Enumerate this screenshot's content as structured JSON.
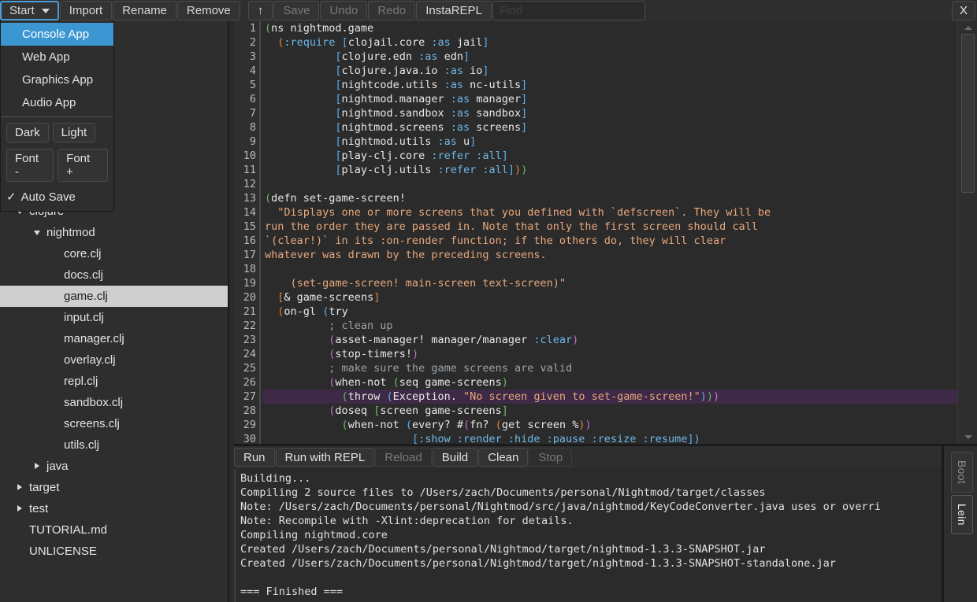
{
  "toolbar": {
    "start_label": "Start",
    "import_label": "Import",
    "rename_label": "Rename",
    "remove_label": "Remove",
    "up_label": "↑",
    "save_label": "Save",
    "undo_label": "Undo",
    "redo_label": "Redo",
    "instarepl_label": "InstaREPL",
    "find_placeholder": "Find",
    "find_value": "",
    "close_label": "X"
  },
  "start_menu": {
    "items": [
      {
        "label": "Console App",
        "selected": true
      },
      {
        "label": "Web App",
        "selected": false
      },
      {
        "label": "Graphics App",
        "selected": false
      },
      {
        "label": "Audio App",
        "selected": false
      }
    ],
    "theme_dark": "Dark",
    "theme_light": "Light",
    "font_minus": "Font -",
    "font_plus": "Font +",
    "auto_save_check": "✓",
    "auto_save_label": "Auto Save"
  },
  "sidebar": {
    "tree": [
      {
        "label": "clojure",
        "indent": 1,
        "twisty": "down"
      },
      {
        "label": "nightmod",
        "indent": 2,
        "twisty": "down"
      },
      {
        "label": "core.clj",
        "indent": 3,
        "twisty": "none"
      },
      {
        "label": "docs.clj",
        "indent": 3,
        "twisty": "none"
      },
      {
        "label": "game.clj",
        "indent": 3,
        "twisty": "none",
        "selected": true
      },
      {
        "label": "input.clj",
        "indent": 3,
        "twisty": "none"
      },
      {
        "label": "manager.clj",
        "indent": 3,
        "twisty": "none"
      },
      {
        "label": "overlay.clj",
        "indent": 3,
        "twisty": "none"
      },
      {
        "label": "repl.clj",
        "indent": 3,
        "twisty": "none"
      },
      {
        "label": "sandbox.clj",
        "indent": 3,
        "twisty": "none"
      },
      {
        "label": "screens.clj",
        "indent": 3,
        "twisty": "none"
      },
      {
        "label": "utils.clj",
        "indent": 3,
        "twisty": "none"
      },
      {
        "label": "java",
        "indent": 2,
        "twisty": "right"
      },
      {
        "label": "target",
        "indent": 1,
        "twisty": "right"
      },
      {
        "label": "test",
        "indent": 1,
        "twisty": "right"
      },
      {
        "label": "TUTORIAL.md",
        "indent": 1,
        "twisty": "none"
      },
      {
        "label": "UNLICENSE",
        "indent": 1,
        "twisty": "none"
      }
    ]
  },
  "editor": {
    "first_line": 1,
    "last_line": 30,
    "current_line": 27,
    "lines": [
      {
        "n": 1,
        "tokens": [
          {
            "t": "(",
            "c": "p4"
          },
          {
            "t": "ns nightmod.game",
            "c": ""
          }
        ]
      },
      {
        "n": 2,
        "tokens": [
          {
            "t": "  ",
            "c": ""
          },
          {
            "t": "(",
            "c": "p1"
          },
          {
            "t": ":require",
            "c": "kw"
          },
          {
            "t": " ",
            "c": ""
          },
          {
            "t": "[",
            "c": "p2"
          },
          {
            "t": "clojail.core ",
            "c": ""
          },
          {
            "t": ":as",
            "c": "kw"
          },
          {
            "t": " jail",
            "c": ""
          },
          {
            "t": "]",
            "c": "p2"
          }
        ]
      },
      {
        "n": 3,
        "tokens": [
          {
            "t": "           ",
            "c": ""
          },
          {
            "t": "[",
            "c": "p2"
          },
          {
            "t": "clojure.edn ",
            "c": ""
          },
          {
            "t": ":as",
            "c": "kw"
          },
          {
            "t": " edn",
            "c": ""
          },
          {
            "t": "]",
            "c": "p2"
          }
        ]
      },
      {
        "n": 4,
        "tokens": [
          {
            "t": "           ",
            "c": ""
          },
          {
            "t": "[",
            "c": "p2"
          },
          {
            "t": "clojure.java.io ",
            "c": ""
          },
          {
            "t": ":as",
            "c": "kw"
          },
          {
            "t": " io",
            "c": ""
          },
          {
            "t": "]",
            "c": "p2"
          }
        ]
      },
      {
        "n": 5,
        "tokens": [
          {
            "t": "           ",
            "c": ""
          },
          {
            "t": "[",
            "c": "p2"
          },
          {
            "t": "nightcode.utils ",
            "c": ""
          },
          {
            "t": ":as",
            "c": "kw"
          },
          {
            "t": " nc-utils",
            "c": ""
          },
          {
            "t": "]",
            "c": "p2"
          }
        ]
      },
      {
        "n": 6,
        "tokens": [
          {
            "t": "           ",
            "c": ""
          },
          {
            "t": "[",
            "c": "p2"
          },
          {
            "t": "nightmod.manager ",
            "c": ""
          },
          {
            "t": ":as",
            "c": "kw"
          },
          {
            "t": " manager",
            "c": ""
          },
          {
            "t": "]",
            "c": "p2"
          }
        ]
      },
      {
        "n": 7,
        "tokens": [
          {
            "t": "           ",
            "c": ""
          },
          {
            "t": "[",
            "c": "p2"
          },
          {
            "t": "nightmod.sandbox ",
            "c": ""
          },
          {
            "t": ":as",
            "c": "kw"
          },
          {
            "t": " sandbox",
            "c": ""
          },
          {
            "t": "]",
            "c": "p2"
          }
        ]
      },
      {
        "n": 8,
        "tokens": [
          {
            "t": "           ",
            "c": ""
          },
          {
            "t": "[",
            "c": "p2"
          },
          {
            "t": "nightmod.screens ",
            "c": ""
          },
          {
            "t": ":as",
            "c": "kw"
          },
          {
            "t": " screens",
            "c": ""
          },
          {
            "t": "]",
            "c": "p2"
          }
        ]
      },
      {
        "n": 9,
        "tokens": [
          {
            "t": "           ",
            "c": ""
          },
          {
            "t": "[",
            "c": "p2"
          },
          {
            "t": "nightmod.utils ",
            "c": ""
          },
          {
            "t": ":as",
            "c": "kw"
          },
          {
            "t": " u",
            "c": ""
          },
          {
            "t": "]",
            "c": "p2"
          }
        ]
      },
      {
        "n": 10,
        "tokens": [
          {
            "t": "           ",
            "c": ""
          },
          {
            "t": "[",
            "c": "p2"
          },
          {
            "t": "play-clj.core ",
            "c": ""
          },
          {
            "t": ":refer",
            "c": "kw"
          },
          {
            "t": " ",
            "c": ""
          },
          {
            "t": ":all",
            "c": "kw"
          },
          {
            "t": "]",
            "c": "p2"
          }
        ]
      },
      {
        "n": 11,
        "tokens": [
          {
            "t": "           ",
            "c": ""
          },
          {
            "t": "[",
            "c": "p2"
          },
          {
            "t": "play-clj.utils ",
            "c": ""
          },
          {
            "t": ":refer",
            "c": "kw"
          },
          {
            "t": " ",
            "c": ""
          },
          {
            "t": ":all",
            "c": "kw"
          },
          {
            "t": "]",
            "c": "p2"
          },
          {
            "t": ")",
            "c": "p1"
          },
          {
            "t": ")",
            "c": "p4"
          }
        ]
      },
      {
        "n": 12,
        "tokens": []
      },
      {
        "n": 13,
        "tokens": [
          {
            "t": "(",
            "c": "p4"
          },
          {
            "t": "defn set-game-screen!",
            "c": ""
          }
        ]
      },
      {
        "n": 14,
        "tokens": [
          {
            "t": "  \"Displays one or more screens that you defined with `defscreen`. They will be",
            "c": "str"
          }
        ]
      },
      {
        "n": 15,
        "tokens": [
          {
            "t": "run the order they are passed in. Note that only the first screen should call",
            "c": "str"
          }
        ]
      },
      {
        "n": 16,
        "tokens": [
          {
            "t": "`(clear!)` in its :on-render function; if the others do, they will clear",
            "c": "str"
          }
        ]
      },
      {
        "n": 17,
        "tokens": [
          {
            "t": "whatever was drawn by the preceding screens.",
            "c": "str"
          }
        ]
      },
      {
        "n": 18,
        "tokens": []
      },
      {
        "n": 19,
        "tokens": [
          {
            "t": "    (set-game-screen! main-screen text-screen)\"",
            "c": "str"
          }
        ]
      },
      {
        "n": 20,
        "tokens": [
          {
            "t": "  ",
            "c": ""
          },
          {
            "t": "[",
            "c": "p1"
          },
          {
            "t": "& game-screens",
            "c": ""
          },
          {
            "t": "]",
            "c": "p1"
          }
        ]
      },
      {
        "n": 21,
        "tokens": [
          {
            "t": "  ",
            "c": ""
          },
          {
            "t": "(",
            "c": "p1"
          },
          {
            "t": "on-gl ",
            "c": ""
          },
          {
            "t": "(",
            "c": "p2"
          },
          {
            "t": "try",
            "c": ""
          }
        ]
      },
      {
        "n": 22,
        "tokens": [
          {
            "t": "          ; clean up",
            "c": "cmt"
          }
        ]
      },
      {
        "n": 23,
        "tokens": [
          {
            "t": "          ",
            "c": ""
          },
          {
            "t": "(",
            "c": "p3"
          },
          {
            "t": "asset-manager! manager/manager ",
            "c": ""
          },
          {
            "t": ":clear",
            "c": "kw"
          },
          {
            "t": ")",
            "c": "p3"
          }
        ]
      },
      {
        "n": 24,
        "tokens": [
          {
            "t": "          ",
            "c": ""
          },
          {
            "t": "(",
            "c": "p3"
          },
          {
            "t": "stop-timers!",
            "c": ""
          },
          {
            "t": ")",
            "c": "p3"
          }
        ]
      },
      {
        "n": 25,
        "tokens": [
          {
            "t": "          ; make sure the game screens are valid",
            "c": "cmt"
          }
        ]
      },
      {
        "n": 26,
        "tokens": [
          {
            "t": "          ",
            "c": ""
          },
          {
            "t": "(",
            "c": "p3"
          },
          {
            "t": "when-not ",
            "c": ""
          },
          {
            "t": "(",
            "c": "p4"
          },
          {
            "t": "seq game-screens",
            "c": ""
          },
          {
            "t": ")",
            "c": "p4"
          }
        ]
      },
      {
        "n": 27,
        "tokens": [
          {
            "t": "            ",
            "c": ""
          },
          {
            "t": "(",
            "c": "p4"
          },
          {
            "t": "throw ",
            "c": ""
          },
          {
            "t": "(",
            "c": "p2"
          },
          {
            "t": "Exception. ",
            "c": ""
          },
          {
            "t": "\"No screen given to set-game-screen!\"",
            "c": "str"
          },
          {
            "t": ")",
            "c": "p2"
          },
          {
            "t": ")",
            "c": "p4"
          },
          {
            "t": ")",
            "c": "p3"
          }
        ],
        "highlight": true
      },
      {
        "n": 28,
        "tokens": [
          {
            "t": "          ",
            "c": ""
          },
          {
            "t": "(",
            "c": "p3"
          },
          {
            "t": "doseq ",
            "c": ""
          },
          {
            "t": "[",
            "c": "p4"
          },
          {
            "t": "screen game-screens",
            "c": ""
          },
          {
            "t": "]",
            "c": "p4"
          }
        ]
      },
      {
        "n": 29,
        "tokens": [
          {
            "t": "            ",
            "c": ""
          },
          {
            "t": "(",
            "c": "p4"
          },
          {
            "t": "when-not ",
            "c": ""
          },
          {
            "t": "(",
            "c": "p2"
          },
          {
            "t": "every? #",
            "c": ""
          },
          {
            "t": "(",
            "c": "p3"
          },
          {
            "t": "fn? ",
            "c": ""
          },
          {
            "t": "(",
            "c": "p1"
          },
          {
            "t": "get screen %",
            "c": ""
          },
          {
            "t": ")",
            "c": "p1"
          },
          {
            "t": ")",
            "c": "p3"
          }
        ]
      },
      {
        "n": 30,
        "tokens": [
          {
            "t": "                       ",
            "c": ""
          },
          {
            "t": "[",
            "c": "p2"
          },
          {
            "t": ":show :render :hide :pause :resize :resume",
            "c": "kw"
          },
          {
            "t": "]",
            "c": "p2"
          },
          {
            "t": ")",
            "c": "p2"
          }
        ]
      }
    ]
  },
  "bottom_panel": {
    "buttons": [
      {
        "label": "Run",
        "enabled": true
      },
      {
        "label": "Run with REPL",
        "enabled": true
      },
      {
        "label": "Reload",
        "enabled": false
      },
      {
        "label": "Build",
        "enabled": true
      },
      {
        "label": "Clean",
        "enabled": true
      },
      {
        "label": "Stop",
        "enabled": false
      }
    ],
    "console_lines": [
      "Building...",
      "Compiling 2 source files to /Users/zach/Documents/personal/Nightmod/target/classes",
      "Note: /Users/zach/Documents/personal/Nightmod/src/java/nightmod/KeyCodeConverter.java uses or overri",
      "Note: Recompile with -Xlint:deprecation for details.",
      "Compiling nightmod.core",
      "Created /Users/zach/Documents/personal/Nightmod/target/nightmod-1.3.3-SNAPSHOT.jar",
      "Created /Users/zach/Documents/personal/Nightmod/target/nightmod-1.3.3-SNAPSHOT-standalone.jar",
      "",
      "=== Finished ==="
    ]
  },
  "side_tabs": [
    {
      "label": "Boot",
      "active": false
    },
    {
      "label": "Lein",
      "active": true
    }
  ],
  "colors": {
    "accent": "#3b96d2",
    "window_bg": "#2b2b2b",
    "panel_bg": "#2e2e2e",
    "selection_bg": "#cfcfcf",
    "current_line_bg": "#3e2a46"
  }
}
